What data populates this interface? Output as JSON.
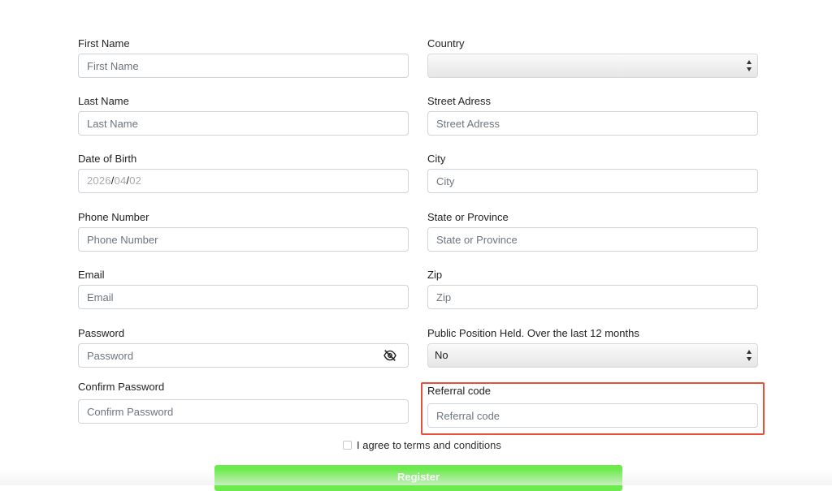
{
  "form": {
    "first_name": {
      "label": "First Name",
      "placeholder": "First Name"
    },
    "last_name": {
      "label": "Last Name",
      "placeholder": "Last Name"
    },
    "dob": {
      "label": "Date of Birth",
      "year": "2026",
      "month": "04",
      "day": "02",
      "sep": "/"
    },
    "phone": {
      "label": "Phone Number",
      "placeholder": "Phone Number"
    },
    "email": {
      "label": "Email",
      "placeholder": "Email"
    },
    "password": {
      "label": "Password",
      "placeholder": "Password",
      "toggle_icon": "eye-slash-icon"
    },
    "confirm_password": {
      "label": "Confirm Password",
      "placeholder": "Confirm Password"
    },
    "country": {
      "label": "Country",
      "value": ""
    },
    "street": {
      "label": "Street Adress",
      "placeholder": "Street Adress"
    },
    "city": {
      "label": "City",
      "placeholder": "City"
    },
    "state": {
      "label": "State or Province",
      "placeholder": "State or Province"
    },
    "zip": {
      "label": "Zip",
      "placeholder": "Zip"
    },
    "public_position": {
      "label": "Public Position Held. Over the last 12 months",
      "value": "No"
    },
    "referral": {
      "label": "Referral code",
      "placeholder": "Referral code"
    }
  },
  "agree": {
    "prefix": "I agree to",
    "link": "terms and conditions",
    "checked": false
  },
  "register": {
    "label": "Register",
    "color": "#6ceb4d"
  },
  "highlight": {
    "color": "#e8503a"
  }
}
